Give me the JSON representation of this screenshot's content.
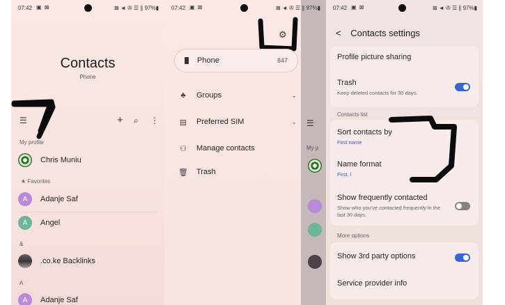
{
  "status_bar": {
    "time": "07:42",
    "left_icons": "▣ ⊠",
    "right_icons": "⊠ ◄ ✇ ☰ ∥",
    "battery": "97%▮"
  },
  "screen1": {
    "title": "Contacts",
    "subtitle": "Phone",
    "toolbar": {
      "menu_icon": "☰",
      "add_icon": "+",
      "search_icon": "⌕",
      "more_icon": "⋮"
    },
    "my_profile_label": "My profile",
    "profile_name": "Chris Muniu",
    "favorites_label": "★ Favorites",
    "favorites": [
      {
        "initial": "A",
        "name": "Adanje Saf",
        "color": "#b98ad9"
      },
      {
        "initial": "A",
        "name": "Angel",
        "color": "#6eb59a"
      }
    ],
    "group_amp": "&",
    "amp_contact": ".co.ke Backlinks",
    "group_a": "A",
    "a_contact": {
      "initial": "A",
      "name": "Adanje Saf",
      "color": "#b98ad9"
    }
  },
  "screen2": {
    "settings_icon": "⚙",
    "phone_label": "Phone",
    "phone_count": "847",
    "items": [
      {
        "icon": "♣",
        "label": "Groups",
        "chevron": "⌄"
      },
      {
        "icon": "▤",
        "label": "Preferred SIM",
        "chevron": "⌄"
      },
      {
        "icon": "⚇",
        "label": "Manage contacts",
        "chevron": ""
      },
      {
        "icon": "🗑",
        "label": "Trash",
        "chevron": ""
      }
    ],
    "peek_menu_icon": "☰",
    "peek_text_my": "My p"
  },
  "screen3": {
    "back_icon": "<",
    "title": "Contacts settings",
    "profile_picture_sharing": "Profile picture sharing",
    "trash_title": "Trash",
    "trash_sub": "Keep deleted contacts for 30 days.",
    "trash_on": true,
    "contacts_list_header": "Contacts list",
    "sort_title": "Sort contacts by",
    "sort_value": "First name",
    "name_format_title": "Name format",
    "name_format_value": "First, l",
    "frequent_title": "Show frequently contacted",
    "frequent_sub": "Show who you've contacted frequently in the last 30 days.",
    "frequent_on": false,
    "more_options_header": "More options",
    "third_party_title": "Show 3rd party options",
    "third_party_on": true,
    "service_provider": "Service provider info"
  },
  "colors": {
    "accent_toggle": "#3a63d4",
    "scribble": "#0c0c0c"
  }
}
